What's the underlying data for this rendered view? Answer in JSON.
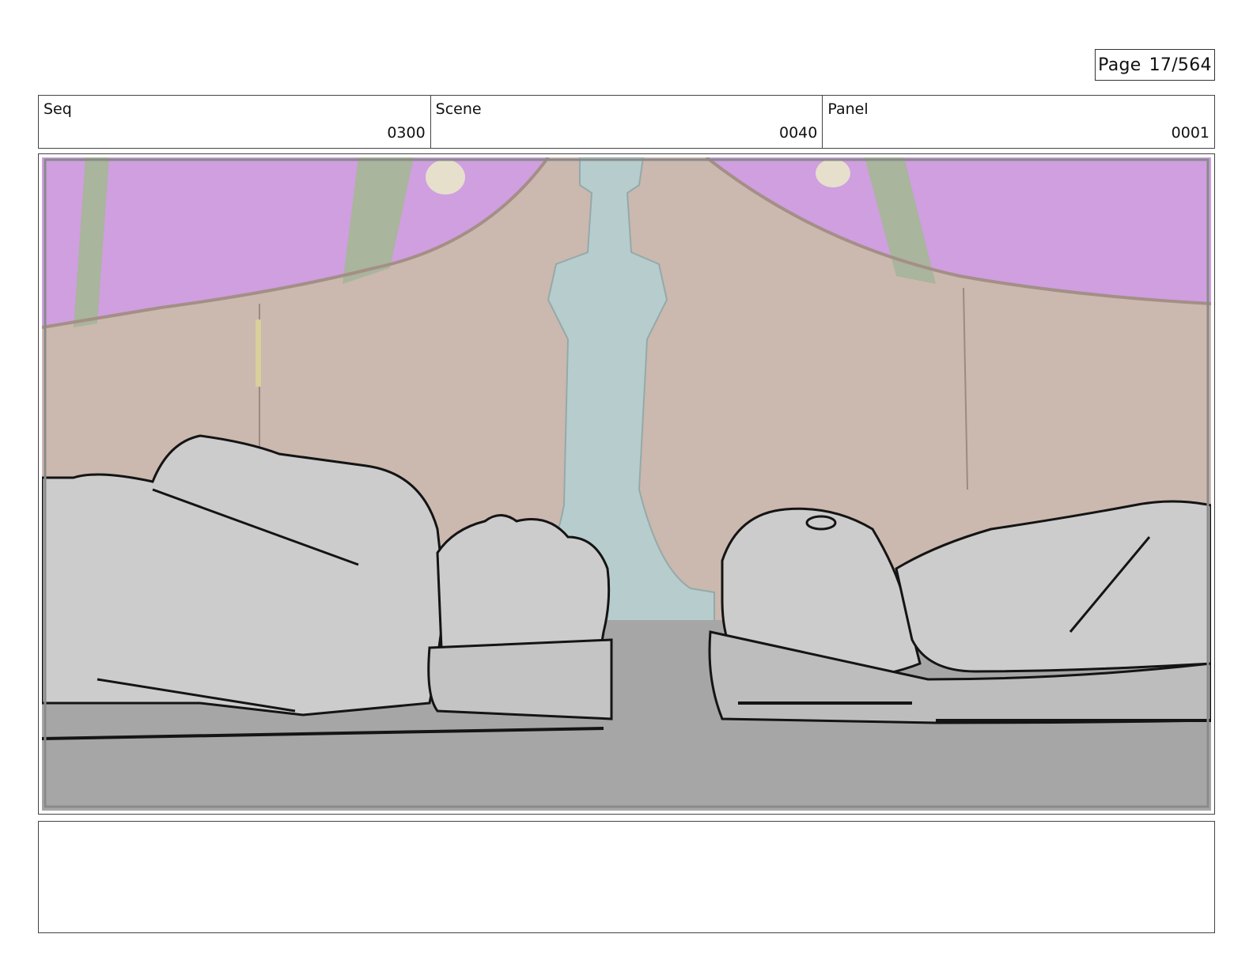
{
  "page": {
    "label": "Page",
    "current": "17/564"
  },
  "header": {
    "seq": {
      "label": "Seq",
      "value": "0300"
    },
    "scene": {
      "label": "Scene",
      "value": "0040"
    },
    "panel": {
      "label": "Panel",
      "value": "0001"
    }
  },
  "panel_image": {
    "icon": "storyboard-sketch-two-figures-lying-down",
    "colors": {
      "curtain": "#cf9fe0",
      "wall": "#cbb8ae",
      "pillar": "#b7cdcd",
      "floor": "#a6a6a6",
      "figure": "#cccccc",
      "ink": "#141414"
    }
  },
  "notes": {
    "text": ""
  }
}
